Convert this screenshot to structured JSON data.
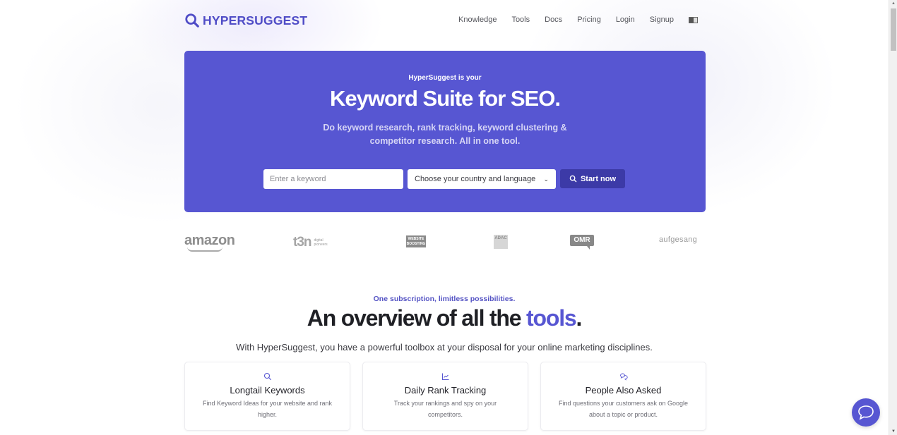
{
  "header": {
    "logo_text": "HYPERSUGGEST",
    "nav": [
      {
        "label": "Knowledge"
      },
      {
        "label": "Tools"
      },
      {
        "label": "Docs"
      },
      {
        "label": "Pricing"
      },
      {
        "label": "Login"
      },
      {
        "label": "Signup"
      }
    ],
    "language_icon": "language-flag-icon"
  },
  "hero": {
    "kicker": "HyperSuggest is your",
    "title": "Keyword Suite for SEO.",
    "subtitle": "Do keyword research, rank tracking, keyword clustering & competitor research. All in one tool.",
    "keyword_input": {
      "value": "",
      "placeholder": "Enter a keyword"
    },
    "country_select": {
      "selected": "Choose your country and language"
    },
    "start_button": "Start now",
    "background_color": "#5756d2"
  },
  "brands": [
    {
      "name": "amazon"
    },
    {
      "name": "t3n",
      "tagline_1": "digital",
      "tagline_2": "pioneers"
    },
    {
      "name": "WEBSITE BOOSTING",
      "line1": "WEBSITE",
      "line2": "BOOSTING"
    },
    {
      "name": "ADAC"
    },
    {
      "name": "OMR"
    },
    {
      "name": "aufgesang"
    }
  ],
  "overview": {
    "kicker": "One subscription, limitless possibilities.",
    "title_main": "An overview of all the ",
    "title_accent": "tools",
    "title_end": ".",
    "subtitle": "With HyperSuggest, you have a powerful toolbox at your disposal for your online marketing disciplines."
  },
  "cards": [
    {
      "icon": "search-icon",
      "title": "Longtail Keywords",
      "desc": "Find Keyword Ideas for your website and rank higher."
    },
    {
      "icon": "chart-line-icon",
      "title": "Daily Rank Tracking",
      "desc": "Track your rankings and spy on your competitors."
    },
    {
      "icon": "chat-bubbles-icon",
      "title": "People Also Asked",
      "desc": "Find questions your customers ask on Google about a topic or product."
    }
  ],
  "colors": {
    "accent": "#5756d2",
    "button_dark": "#3c3aa7",
    "logo": "#4f4cc6"
  }
}
